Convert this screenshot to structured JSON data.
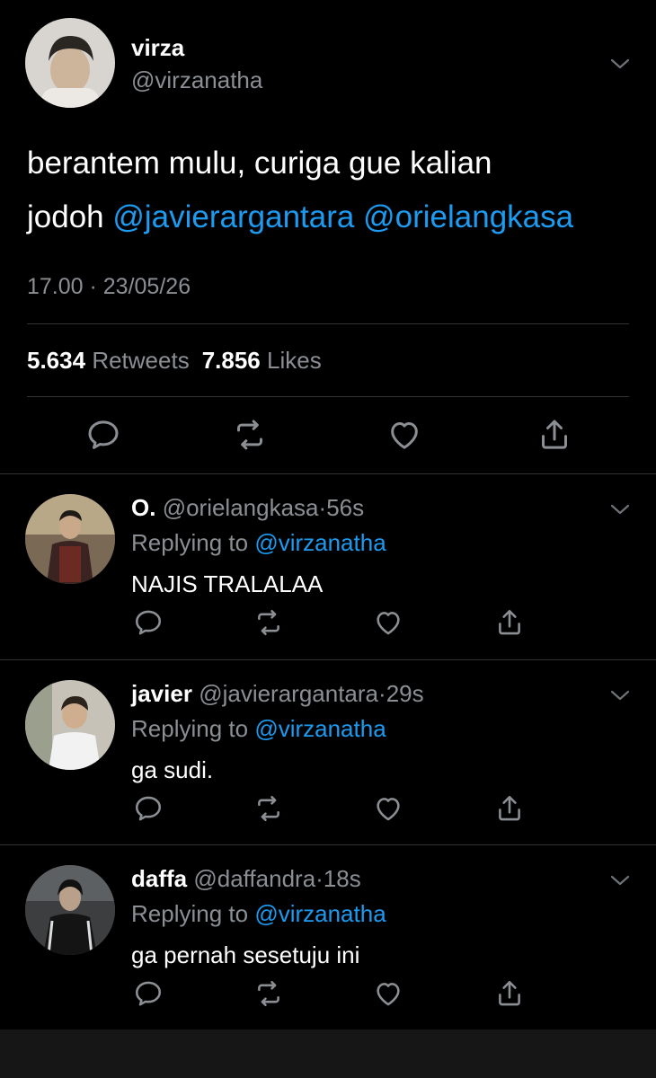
{
  "main": {
    "name": "virza",
    "handle": "@virzanatha",
    "text_plain": "berantem mulu, curiga gue kalian",
    "text_line2_prefix": "jodoh ",
    "mention1": "@javierargantara",
    "mention2": "@orielangkasa",
    "timestamp": "17.00 · 23/05/26",
    "retweets_count": "5.634",
    "retweets_label": "Retweets",
    "likes_count": "7.856",
    "likes_label": "Likes"
  },
  "replies": [
    {
      "name": "O.",
      "handle": "@orielangkasa",
      "dot": "·",
      "time": "56s",
      "replying_prefix": "Replying to",
      "replying_to": "@virzanatha",
      "text": "NAJIS TRALALAA"
    },
    {
      "name": "javier",
      "handle": "@javierargantara",
      "dot": "·",
      "time": "29s",
      "replying_prefix": "Replying to",
      "replying_to": "@virzanatha",
      "text": "ga sudi."
    },
    {
      "name": "daffa",
      "handle": "@daffandra",
      "dot": "·",
      "time": "18s",
      "replying_prefix": "Replying to",
      "replying_to": "@virzanatha",
      "text": "ga pernah sesetuju ini"
    }
  ],
  "colors": {
    "background": "#000000",
    "mention": "#1d9bf0",
    "muted": "#8b8f94",
    "separator": "#2f3336"
  },
  "icons": [
    "chevron-down-icon",
    "reply-icon",
    "retweet-icon",
    "like-icon",
    "share-icon"
  ]
}
